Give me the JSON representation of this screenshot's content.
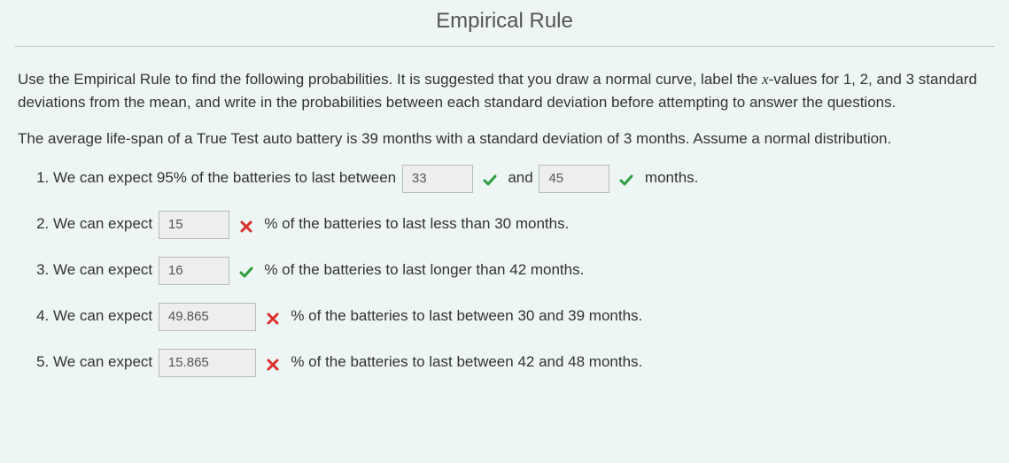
{
  "title": "Empirical Rule",
  "intro1_a": "Use the Empirical Rule to find the following probabilities. It is suggested that you draw a normal curve, label the ",
  "intro1_var": "x",
  "intro1_b": "-values for 1, 2, and 3 standard deviations from the mean, and write in the probabilities between each standard deviation before attempting to answer the questions.",
  "intro2": "The average life-span of a True Test auto battery is 39 months with a standard deviation of 3 months. Assume a normal distribution.",
  "q1": {
    "lead": "We can expect 95% of the batteries to last between",
    "ans1": "33",
    "mark1": "correct",
    "mid": "and",
    "ans2": "45",
    "mark2": "correct",
    "tail": "months."
  },
  "q2": {
    "lead": "We can expect",
    "ans": "15",
    "mark": "incorrect",
    "tail": "% of the batteries to last less than 30 months."
  },
  "q3": {
    "lead": "We can expect",
    "ans": "16",
    "mark": "correct",
    "tail": "% of the batteries to last longer than 42 months."
  },
  "q4": {
    "lead": "We can expect",
    "ans": "49.865",
    "mark": "incorrect",
    "tail": "% of the batteries to last between 30 and 39 months."
  },
  "q5": {
    "lead": "We can expect",
    "ans": "15.865",
    "mark": "incorrect",
    "tail": "% of the batteries to last between 42 and 48 months."
  }
}
